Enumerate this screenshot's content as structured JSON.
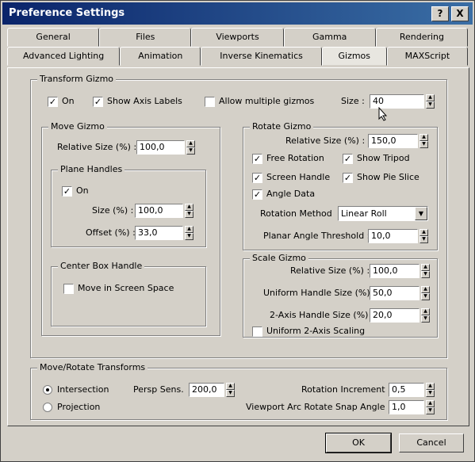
{
  "window": {
    "title": "Preference Settings",
    "help_label": "?",
    "close_label": "X"
  },
  "tabs_row1": [
    "General",
    "Files",
    "Viewports",
    "Gamma",
    "Rendering"
  ],
  "tabs_row2": [
    "Advanced Lighting",
    "Animation",
    "Inverse Kinematics",
    "Gizmos",
    "MAXScript"
  ],
  "transform_gizmo": {
    "label": "Transform Gizmo",
    "on_label": "On",
    "on_checked": true,
    "show_axis_label": "Show Axis Labels",
    "show_axis_checked": true,
    "allow_multiple_label": "Allow multiple gizmos",
    "allow_multiple_checked": false,
    "size_label": "Size :",
    "size_value": "40"
  },
  "move_gizmo": {
    "label": "Move Gizmo",
    "relative_size_label": "Relative Size (%) :",
    "relative_size_value": "100,0",
    "plane_handles": {
      "label": "Plane Handles",
      "on_label": "On",
      "on_checked": true,
      "size_label": "Size (%) :",
      "size_value": "100,0",
      "offset_label": "Offset (%) :",
      "offset_value": "33,0"
    },
    "center_box": {
      "label": "Center Box Handle",
      "move_label": "Move in Screen Space",
      "move_checked": false
    }
  },
  "rotate_gizmo": {
    "label": "Rotate Gizmo",
    "relative_size_label": "Relative Size (%) :",
    "relative_size_value": "150,0",
    "free_rotation": "Free Rotation",
    "free_rotation_checked": true,
    "show_tripod": "Show Tripod",
    "show_tripod_checked": true,
    "screen_handle": "Screen Handle",
    "screen_handle_checked": true,
    "show_pie_slice": "Show Pie Slice",
    "show_pie_slice_checked": true,
    "angle_data": "Angle Data",
    "angle_data_checked": true,
    "rotation_method_label": "Rotation Method",
    "rotation_method_value": "Linear Roll",
    "planar_threshold_label": "Planar Angle Threshold :",
    "planar_threshold_value": "10,0"
  },
  "scale_gizmo": {
    "label": "Scale Gizmo",
    "relative_size_label": "Relative Size (%) :",
    "relative_size_value": "100,0",
    "uniform_label": "Uniform Handle Size (%) :",
    "uniform_value": "50,0",
    "two_axis_label": "2-Axis Handle Size (%) :",
    "two_axis_value": "20,0",
    "uniform_scaling_label": "Uniform 2-Axis Scaling",
    "uniform_scaling_checked": false
  },
  "move_rotate": {
    "label": "Move/Rotate Transforms",
    "intersection_label": "Intersection",
    "intersection_selected": true,
    "projection_label": "Projection",
    "projection_selected": false,
    "persp_label": "Persp Sens.",
    "persp_value": "200,0",
    "rotation_increment_label": "Rotation Increment",
    "rotation_increment_value": "0,5",
    "viewport_arc_label": "Viewport Arc Rotate Snap Angle",
    "viewport_arc_value": "1,0"
  },
  "buttons": {
    "ok": "OK",
    "cancel": "Cancel"
  }
}
